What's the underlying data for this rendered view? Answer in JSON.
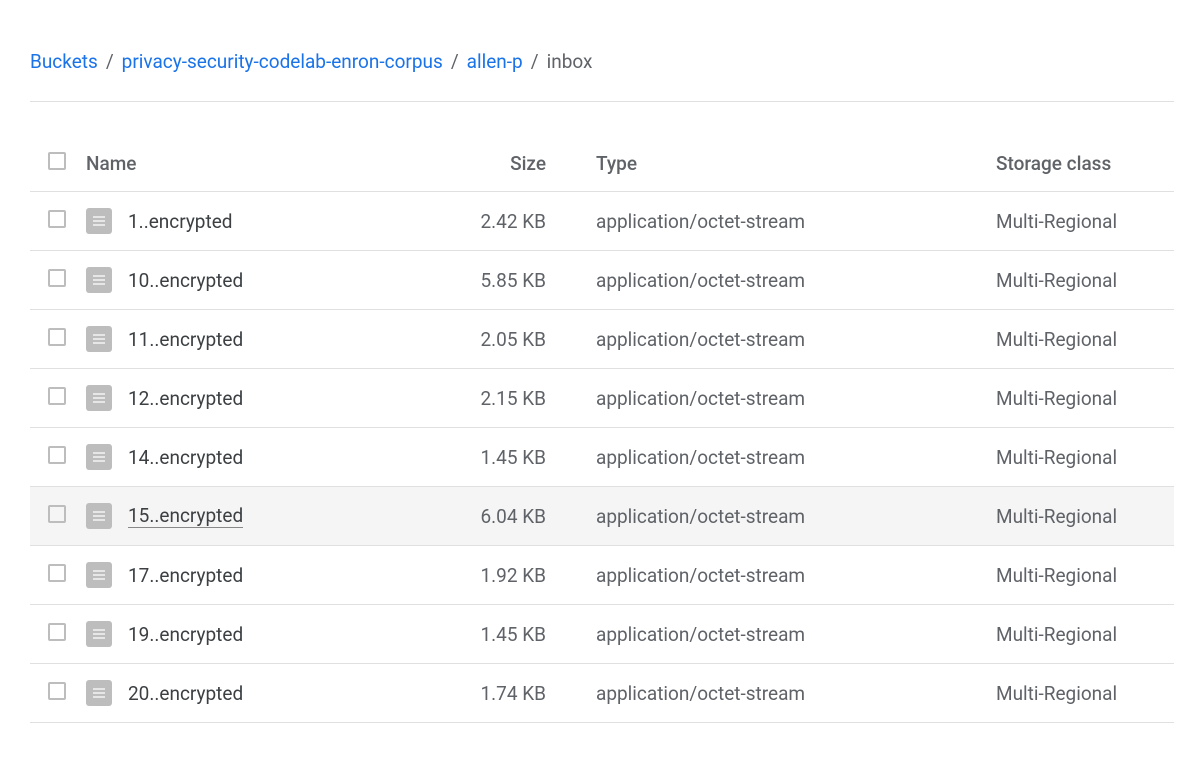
{
  "breadcrumb": {
    "items": [
      {
        "label": "Buckets",
        "link": true
      },
      {
        "label": "privacy-security-codelab-enron-corpus",
        "link": true
      },
      {
        "label": "allen-p",
        "link": true
      },
      {
        "label": "inbox",
        "link": false
      }
    ],
    "separator": "/"
  },
  "table": {
    "headers": {
      "name": "Name",
      "size": "Size",
      "type": "Type",
      "storage": "Storage class"
    },
    "rows": [
      {
        "name": "1..encrypted",
        "size": "2.42 KB",
        "type": "application/octet-stream",
        "storage": "Multi-Regional",
        "hovered": false
      },
      {
        "name": "10..encrypted",
        "size": "5.85 KB",
        "type": "application/octet-stream",
        "storage": "Multi-Regional",
        "hovered": false
      },
      {
        "name": "11..encrypted",
        "size": "2.05 KB",
        "type": "application/octet-stream",
        "storage": "Multi-Regional",
        "hovered": false
      },
      {
        "name": "12..encrypted",
        "size": "2.15 KB",
        "type": "application/octet-stream",
        "storage": "Multi-Regional",
        "hovered": false
      },
      {
        "name": "14..encrypted",
        "size": "1.45 KB",
        "type": "application/octet-stream",
        "storage": "Multi-Regional",
        "hovered": false
      },
      {
        "name": "15..encrypted",
        "size": "6.04 KB",
        "type": "application/octet-stream",
        "storage": "Multi-Regional",
        "hovered": true
      },
      {
        "name": "17..encrypted",
        "size": "1.92 KB",
        "type": "application/octet-stream",
        "storage": "Multi-Regional",
        "hovered": false
      },
      {
        "name": "19..encrypted",
        "size": "1.45 KB",
        "type": "application/octet-stream",
        "storage": "Multi-Regional",
        "hovered": false
      },
      {
        "name": "20..encrypted",
        "size": "1.74 KB",
        "type": "application/octet-stream",
        "storage": "Multi-Regional",
        "hovered": false
      }
    ]
  }
}
